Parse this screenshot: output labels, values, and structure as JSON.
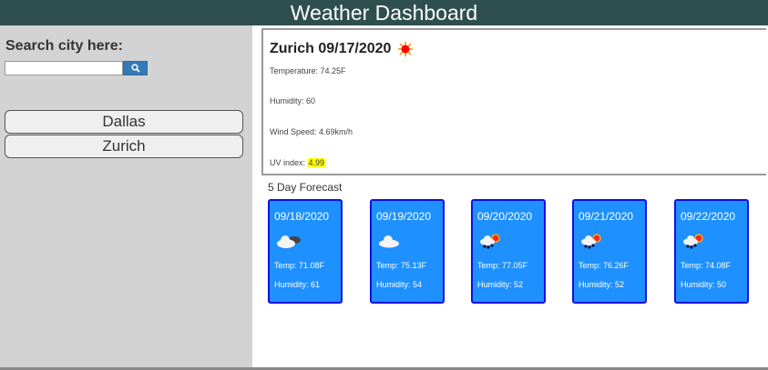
{
  "header": {
    "title": "Weather Dashboard"
  },
  "sidebar": {
    "search_label": "Search city here:",
    "search_value": "",
    "history": [
      "Dallas",
      "Zurich"
    ]
  },
  "current": {
    "title": "Zurich 09/17/2020",
    "icon": "sun-icon",
    "temperature": "Temperature: 74.25F",
    "humidity": "Humidity: 60",
    "wind": "Wind Speed: 4.69km/h",
    "uv_label": "UV index:",
    "uv_value": "4.99",
    "uv_color": "#ffff00"
  },
  "forecast": {
    "title": "5 Day Forecast",
    "days": [
      {
        "date": "09/18/2020",
        "icon": "broken-clouds-icon",
        "temp": "Temp: 71.08F",
        "humidity": "Humidity: 61"
      },
      {
        "date": "09/19/2020",
        "icon": "cloud-icon",
        "temp": "Temp: 75.13F",
        "humidity": "Humidity: 54"
      },
      {
        "date": "09/20/2020",
        "icon": "rain-sun-icon",
        "temp": "Temp: 77.05F",
        "humidity": "Humidity: 52"
      },
      {
        "date": "09/21/2020",
        "icon": "rain-sun-icon",
        "temp": "Temp: 76.26F",
        "humidity": "Humidity: 52"
      },
      {
        "date": "09/22/2020",
        "icon": "rain-sun-icon",
        "temp": "Temp: 74.08F",
        "humidity": "Humidity: 50"
      }
    ]
  }
}
